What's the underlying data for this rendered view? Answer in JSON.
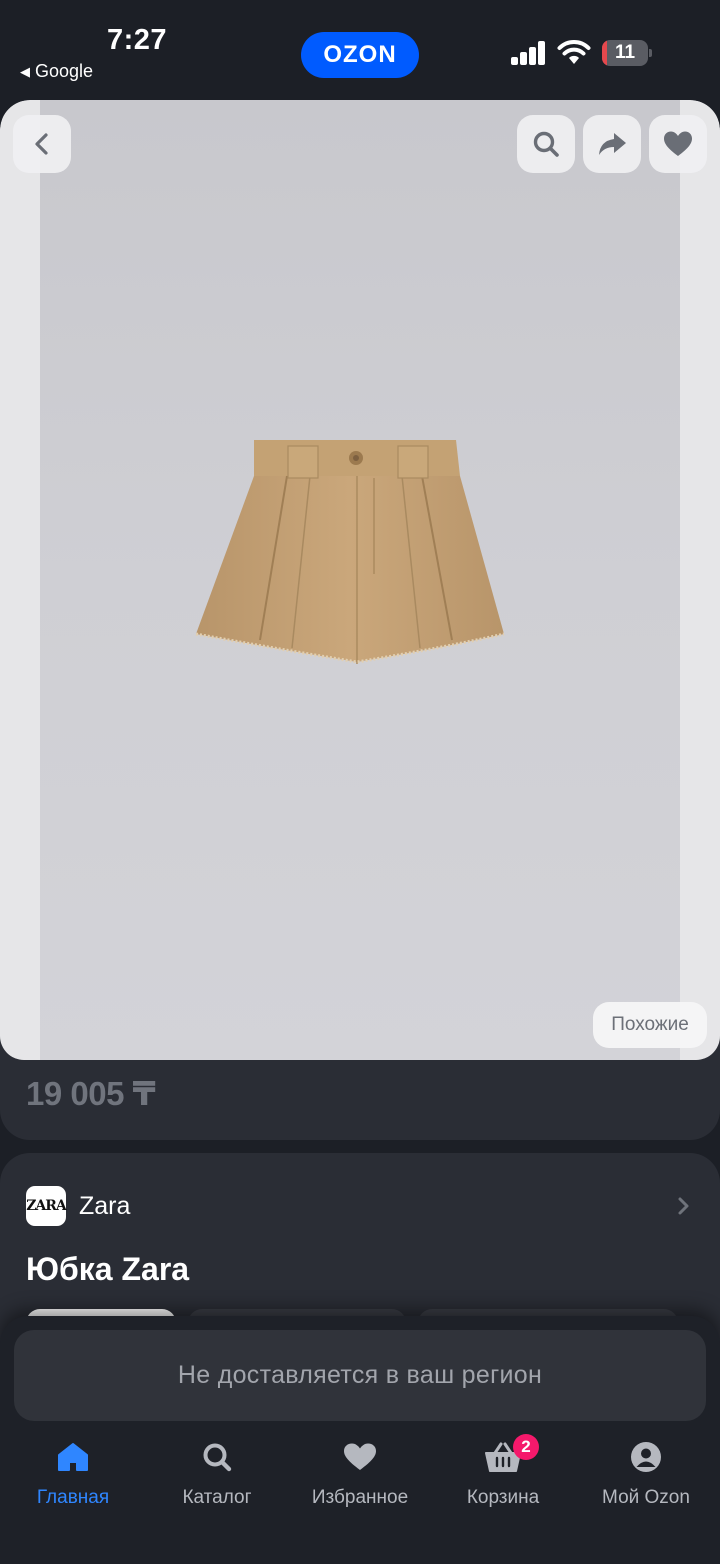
{
  "status_bar": {
    "time": "7:27",
    "back_app": "Google",
    "battery_level": "11",
    "battery_fraction": 0.11
  },
  "app": {
    "logo": "OZON",
    "brand_color": "#005bff"
  },
  "product": {
    "similar_label": "Похожие",
    "price": "19 005 ₸",
    "brand": "Zara",
    "brand_logo": "ZARA",
    "title": "Юбка Zara"
  },
  "notice": "Не доставляется в ваш регион",
  "tabbar": {
    "items": [
      {
        "label": "Главная",
        "icon": "home-icon",
        "active": true
      },
      {
        "label": "Каталог",
        "icon": "search-icon",
        "active": false
      },
      {
        "label": "Избранное",
        "icon": "heart-icon",
        "active": false
      },
      {
        "label": "Корзина",
        "icon": "basket-icon",
        "active": false,
        "badge": "2"
      },
      {
        "label": "Мой Ozon",
        "icon": "profile-icon",
        "active": false
      }
    ]
  },
  "colors": {
    "accent": "#2f86ff",
    "badge": "#f5196b",
    "background": "#1c1f26",
    "card": "#2a2d35"
  }
}
